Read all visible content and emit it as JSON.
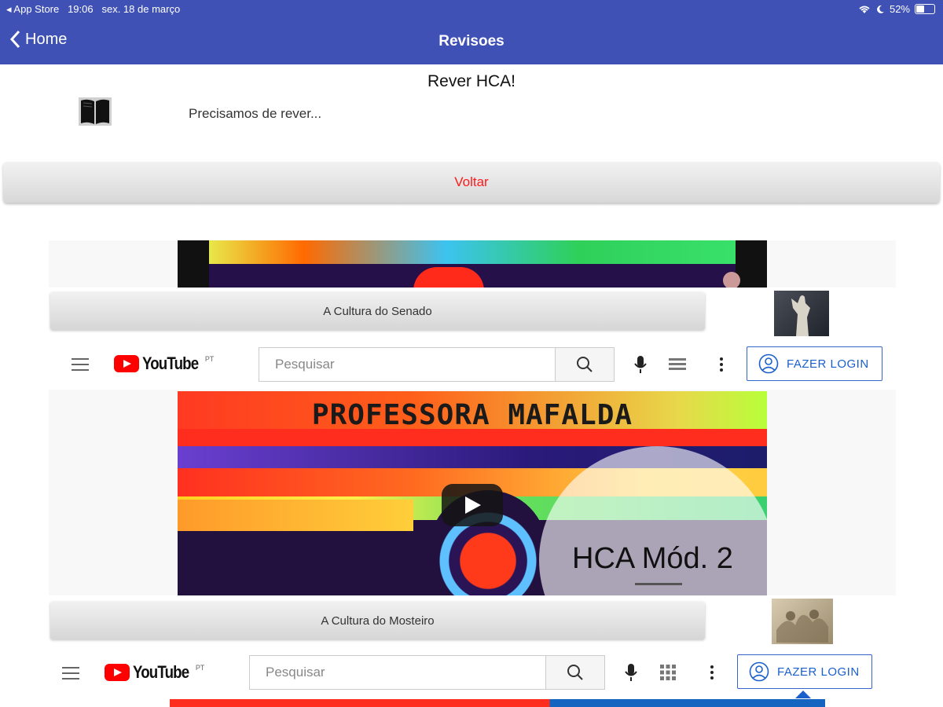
{
  "status": {
    "carrier": "◂ App Store",
    "time": "19:06",
    "date": "sex. 18 de março",
    "battery": "52%",
    "battery_level": 0.52
  },
  "nav": {
    "back_label": "Home",
    "title": "Revisoes"
  },
  "content": {
    "title": "Rever HCA!",
    "text": "Precisamos de rever...",
    "button": "Voltar"
  },
  "videos": [
    {
      "label": "A Cultura do Senado",
      "title_visible": ""
    },
    {
      "label": "A Cultura do Mosteiro",
      "title_visible": "PROFESSORA MAFALDA",
      "overlay": "HCA Mód. 2"
    }
  ],
  "youtube": {
    "logo": "YouTube",
    "country": "PT",
    "search_placeholder": "Pesquisar",
    "login": "FAZER LOGIN"
  },
  "colors": {
    "nav": "#3f51b5",
    "voltar_text": "#ff1a1a",
    "yt_red": "#ff0000",
    "login_blue": "#1a5fcc"
  },
  "icons": [
    "chevron-left-icon",
    "wifi-icon",
    "moon-icon",
    "battery-icon",
    "book-icon",
    "hamburger-icon",
    "search-icon",
    "mic-icon",
    "grid-icon",
    "more-vert-icon",
    "user-circle-icon",
    "play-icon"
  ]
}
